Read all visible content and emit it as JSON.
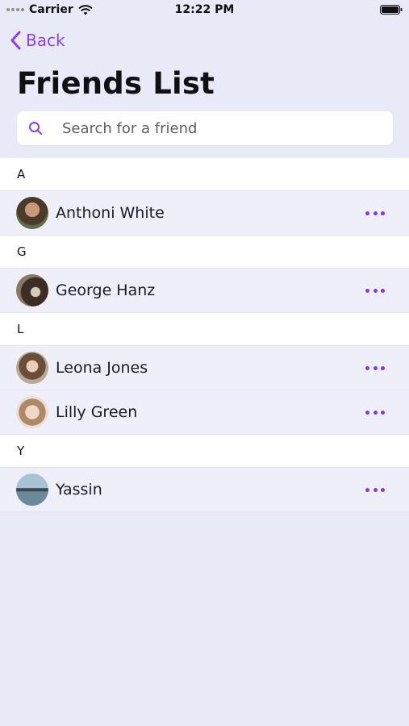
{
  "status_bar": {
    "carrier": "Carrier",
    "time": "12:22 PM"
  },
  "header": {
    "back_label": "Back",
    "title": "Friends List"
  },
  "search": {
    "placeholder": "Search for a friend",
    "value": ""
  },
  "sections": [
    {
      "letter": "A",
      "friends": [
        {
          "name": "Anthoni White",
          "avatar_color": "#4a5a3a"
        }
      ]
    },
    {
      "letter": "G",
      "friends": [
        {
          "name": "George Hanz",
          "avatar_color": "#5a4a3c"
        }
      ]
    },
    {
      "letter": "L",
      "friends": [
        {
          "name": "Leona Jones",
          "avatar_color": "#8a7060"
        },
        {
          "name": "Lilly Green",
          "avatar_color": "#c9a48c"
        }
      ]
    },
    {
      "letter": "Y",
      "friends": [
        {
          "name": "Yassin",
          "avatar_color": "#6a8a9c"
        }
      ]
    }
  ],
  "colors": {
    "accent": "#8a3ff0",
    "background": "#e9eaf8",
    "row_background": "#efeffa",
    "section_background": "#ffffff"
  },
  "icons": {
    "back": "chevron-left-icon",
    "search": "search-icon",
    "more": "ellipsis-icon",
    "wifi": "wifi-icon",
    "battery": "battery-icon"
  }
}
